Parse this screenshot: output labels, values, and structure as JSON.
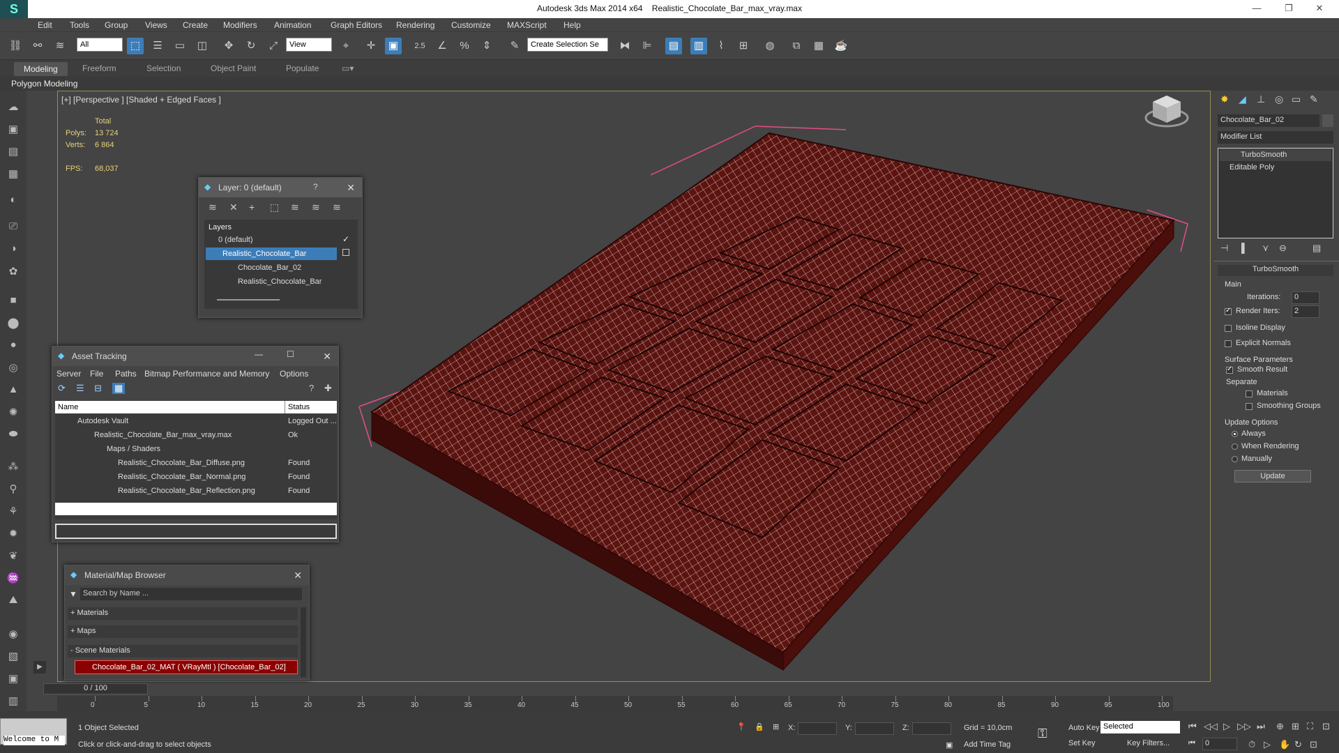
{
  "titlebar": {
    "app": "Autodesk 3ds Max  2014 x64",
    "file": "Realistic_Chocolate_Bar_max_vray.max"
  },
  "menu": [
    "Edit",
    "Tools",
    "Group",
    "Views",
    "Create",
    "Modifiers",
    "Animation",
    "Graph Editors",
    "Rendering",
    "Customize",
    "MAXScript",
    "Help"
  ],
  "toolbar": {
    "filter": "All",
    "refcoord": "View",
    "selset": "Create Selection Se",
    "snap_label": "2.5"
  },
  "ribbon": {
    "tabs": [
      "Modeling",
      "Freeform",
      "Selection",
      "Object Paint",
      "Populate"
    ],
    "sub": "Polygon Modeling"
  },
  "viewport": {
    "label": "[+] [Perspective ] [Shaded + Edged Faces ]",
    "total": "Total",
    "polys_label": "Polys:",
    "polys": "13 724",
    "verts_label": "Verts:",
    "verts": "6 864",
    "fps_label": "FPS:",
    "fps": "68,037"
  },
  "layer": {
    "title": "Layer: 0 (default)",
    "header": "Layers",
    "items": [
      "0 (default)",
      "Realistic_Chocolate_Bar",
      "Chocolate_Bar_02",
      "Realistic_Chocolate_Bar"
    ]
  },
  "asset": {
    "title": "Asset Tracking",
    "menu": [
      "Server",
      "File",
      "Paths",
      "Bitmap Performance and Memory",
      "Options"
    ],
    "col_name": "Name",
    "col_status": "Status",
    "rows": [
      {
        "name": "Autodesk Vault",
        "status": "Logged Out ..."
      },
      {
        "name": "Realistic_Chocolate_Bar_max_vray.max",
        "status": "Ok"
      },
      {
        "name": "Maps / Shaders",
        "status": ""
      },
      {
        "name": "Realistic_Chocolate_Bar_Diffuse.png",
        "status": "Found"
      },
      {
        "name": "Realistic_Chocolate_Bar_Normal.png",
        "status": "Found"
      },
      {
        "name": "Realistic_Chocolate_Bar_Reflection.png",
        "status": "Found"
      }
    ]
  },
  "matbrowser": {
    "title": "Material/Map Browser",
    "search": "Search by Name ...",
    "materials": "+ Materials",
    "maps": "+ Maps",
    "scene": "- Scene Materials",
    "item": "Chocolate_Bar_02_MAT ( VRayMtl ) [Chocolate_Bar_02]"
  },
  "right": {
    "object": "Chocolate_Bar_02",
    "modlist": "Modifier List",
    "stack": [
      "TurboSmooth",
      "Editable Poly"
    ],
    "rollout": "TurboSmooth",
    "main": "Main",
    "iter_label": "Iterations:",
    "iter": "0",
    "render_label": "Render Iters:",
    "render": "2",
    "isoline": "Isoline Display",
    "explicit": "Explicit Normals",
    "surface": "Surface Parameters",
    "smooth": "Smooth Result",
    "separate": "Separate",
    "materials": "Materials",
    "smoothing": "Smoothing Groups",
    "update_opts": "Update Options",
    "always": "Always",
    "when": "When Rendering",
    "manually": "Manually",
    "update": "Update"
  },
  "timeline": {
    "frame": "0 / 100",
    "ticks": [
      "0",
      "5",
      "10",
      "15",
      "20",
      "25",
      "30",
      "35",
      "40",
      "45",
      "50",
      "55",
      "60",
      "65",
      "70",
      "75",
      "80",
      "85",
      "90",
      "95",
      "100"
    ]
  },
  "status": {
    "welcome": "Welcome to M",
    "selected": "1 Object Selected",
    "hint": "Click or click-and-drag to select objects",
    "x": "X:",
    "y": "Y:",
    "z": "Z:",
    "grid": "Grid = 10,0cm",
    "addtag": "Add Time Tag",
    "autokey": "Auto Key",
    "setkey": "Set Key",
    "selected_dd": "Selected",
    "keyfilters": "Key Filters...",
    "frame_field": "0"
  }
}
